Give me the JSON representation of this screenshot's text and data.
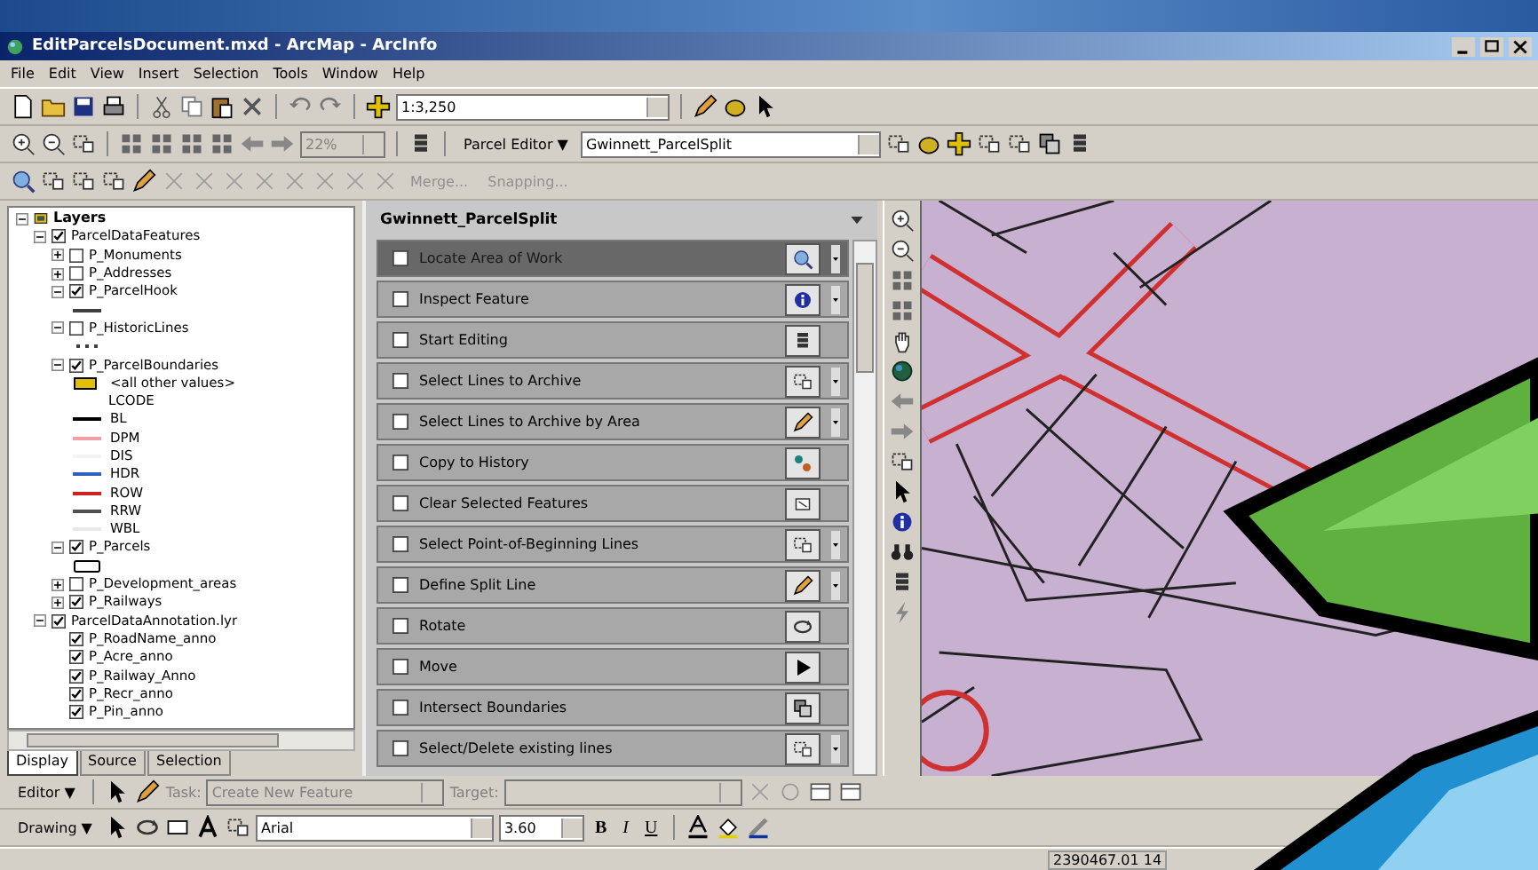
{
  "window": {
    "title": "EditParcelsDocument.mxd - ArcMap - ArcInfo"
  },
  "menu": [
    "File",
    "Edit",
    "View",
    "Insert",
    "Selection",
    "Tools",
    "Window",
    "Help"
  ],
  "standard_toolbar": {
    "scale": "1:3,250"
  },
  "parcel_toolbar": {
    "zoom": "22%",
    "editor_menu": "Parcel Editor ▼",
    "task_layer": "Gwinnett_ParcelSplit"
  },
  "topology_toolbar": {
    "buttons": [
      {
        "label": "Merge...",
        "disabled": true
      },
      {
        "label": "Snapping...",
        "disabled": true
      }
    ]
  },
  "toc": {
    "layers": [
      {
        "kind": "frame",
        "label": "Layers",
        "expanded": true,
        "children": [
          {
            "kind": "layer",
            "label": "ParcelDataFeatures",
            "checked": true,
            "expanded": true,
            "children": [
              {
                "kind": "layer",
                "label": "P_Monuments",
                "checked": false,
                "expanded": false
              },
              {
                "kind": "layer",
                "label": "P_Addresses",
                "checked": false,
                "expanded": false
              },
              {
                "kind": "layer",
                "label": "P_ParcelHook",
                "checked": true,
                "expanded": true,
                "children": [
                  {
                    "kind": "line",
                    "color": "#404040"
                  }
                ]
              },
              {
                "kind": "layer",
                "label": "P_HistoricLines",
                "checked": false,
                "expanded": true,
                "children": [
                  {
                    "kind": "dots",
                    "color": "#404040"
                  }
                ]
              },
              {
                "kind": "layer",
                "label": "P_ParcelBoundaries",
                "checked": true,
                "expanded": true,
                "children": [
                  {
                    "kind": "fill",
                    "color": "#e0c000",
                    "label": "<all other values>"
                  },
                  {
                    "kind": "heading",
                    "label": "LCODE"
                  },
                  {
                    "kind": "line",
                    "color": "#000000",
                    "label": "BL"
                  },
                  {
                    "kind": "line",
                    "color": "#f0a0a0",
                    "label": "DPM"
                  },
                  {
                    "kind": "line",
                    "color": "#f4f4f4",
                    "label": "DIS"
                  },
                  {
                    "kind": "line",
                    "color": "#3060c0",
                    "label": "HDR"
                  },
                  {
                    "kind": "line",
                    "color": "#d02020",
                    "label": "ROW"
                  },
                  {
                    "kind": "line",
                    "color": "#505050",
                    "label": "RRW"
                  },
                  {
                    "kind": "line",
                    "color": "#e8e8e8",
                    "label": "WBL"
                  }
                ]
              },
              {
                "kind": "layer",
                "label": "P_Parcels",
                "checked": true,
                "expanded": true,
                "children": [
                  {
                    "kind": "box",
                    "color": "#000000"
                  }
                ]
              },
              {
                "kind": "layer",
                "label": "P_Development_areas",
                "checked": false,
                "expanded": false
              },
              {
                "kind": "layer",
                "label": "P_Railways",
                "checked": true,
                "expanded": false
              }
            ]
          },
          {
            "kind": "layer",
            "label": "ParcelDataAnnotation.lyr",
            "checked": true,
            "expanded": true,
            "children": [
              {
                "kind": "layer",
                "label": "P_RoadName_anno",
                "checked": true
              },
              {
                "kind": "layer",
                "label": "P_Acre_anno",
                "checked": true
              },
              {
                "kind": "layer",
                "label": "P_Railway_Anno",
                "checked": true
              },
              {
                "kind": "layer",
                "label": "P_Recr_anno",
                "checked": true
              },
              {
                "kind": "layer",
                "label": "P_Pin_anno",
                "checked": true
              }
            ]
          }
        ]
      }
    ],
    "tabs": [
      {
        "label": "Display",
        "selected": true
      },
      {
        "label": "Source",
        "selected": false
      },
      {
        "label": "Selection",
        "selected": false
      }
    ]
  },
  "task_panel": {
    "title": "Gwinnett_ParcelSplit",
    "tasks": [
      {
        "label": "Locate Area of Work",
        "selected": true,
        "checked": false,
        "dropdown": true
      },
      {
        "label": "Inspect Feature",
        "selected": false,
        "checked": false,
        "dropdown": true
      },
      {
        "label": "Start Editing",
        "selected": false,
        "checked": false,
        "dropdown": false
      },
      {
        "label": "Select Lines to Archive",
        "selected": false,
        "checked": false,
        "dropdown": true
      },
      {
        "label": "Select Lines to Archive by Area",
        "selected": false,
        "checked": false,
        "dropdown": true
      },
      {
        "label": "Copy to History",
        "selected": false,
        "checked": false,
        "dropdown": false
      },
      {
        "label": "Clear Selected Features",
        "selected": false,
        "checked": false,
        "dropdown": false
      },
      {
        "label": "Select Point-of-Beginning Lines",
        "selected": false,
        "checked": false,
        "dropdown": true
      },
      {
        "label": "Define Split Line",
        "selected": false,
        "checked": false,
        "dropdown": true
      },
      {
        "label": "Rotate",
        "selected": false,
        "checked": false,
        "dropdown": false
      },
      {
        "label": "Move",
        "selected": false,
        "checked": false,
        "dropdown": false
      },
      {
        "label": "Intersect Boundaries",
        "selected": false,
        "checked": false,
        "dropdown": false
      },
      {
        "label": "Select/Delete existing lines",
        "selected": false,
        "checked": false,
        "dropdown": true
      }
    ]
  },
  "editor_toolbar": {
    "menu": "Editor ▼",
    "task_label": "Task:",
    "task": "Create New Feature",
    "target_label": "Target:"
  },
  "drawing_toolbar": {
    "menu": "Drawing ▼",
    "font": "Arial",
    "size": "3.60",
    "bold": "B",
    "italic": "I",
    "underline": "U"
  },
  "status_bar": {
    "coordinates": "2390467.01 14"
  }
}
